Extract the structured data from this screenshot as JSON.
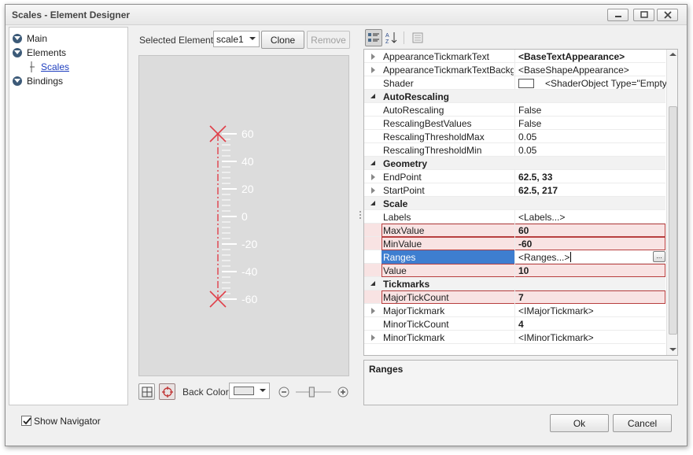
{
  "window": {
    "title": "Scales - Element Designer"
  },
  "nav": {
    "items": [
      {
        "label": "Main"
      },
      {
        "label": "Elements"
      },
      {
        "label": "Scales"
      },
      {
        "label": "Bindings"
      }
    ]
  },
  "selector": {
    "label": "Selected Element:",
    "value": "scale1",
    "clone_label": "Clone",
    "remove_label": "Remove"
  },
  "preview": {
    "ticks": [
      "60",
      "40",
      "20",
      "0",
      "-20",
      "-40",
      "-60"
    ],
    "max_value": 60,
    "min_value": -60,
    "major_tick_count": 7,
    "minor_tick_count": 4
  },
  "bottom_toolbar": {
    "back_color_label": "Back Color:",
    "zoom": 0.45
  },
  "grid": {
    "rows": [
      {
        "kind": "prop",
        "name": "AppearanceTickmarkText",
        "value": "<BaseTextAppearance>",
        "bold": true,
        "expand": true
      },
      {
        "kind": "prop",
        "name": "AppearanceTickmarkTextBackgrou",
        "value": "<BaseShapeAppearance>",
        "bold": false,
        "expand": true
      },
      {
        "kind": "prop",
        "name": "Shader",
        "value": "<ShaderObject Type=\"Empty\"/>",
        "bold": false,
        "expand": false,
        "swatch": true
      },
      {
        "kind": "cat",
        "name": "AutoRescaling"
      },
      {
        "kind": "prop",
        "name": "AutoRescaling",
        "value": "False",
        "bold": false
      },
      {
        "kind": "prop",
        "name": "RescalingBestValues",
        "value": "False",
        "bold": false
      },
      {
        "kind": "prop",
        "name": "RescalingThresholdMax",
        "value": "0.05",
        "bold": false
      },
      {
        "kind": "prop",
        "name": "RescalingThresholdMin",
        "value": "0.05",
        "bold": false
      },
      {
        "kind": "cat",
        "name": "Geometry"
      },
      {
        "kind": "prop",
        "name": "EndPoint",
        "value": "62.5, 33",
        "bold": true,
        "expand": true
      },
      {
        "kind": "prop",
        "name": "StartPoint",
        "value": "62.5, 217",
        "bold": true,
        "expand": true
      },
      {
        "kind": "cat",
        "name": "Scale"
      },
      {
        "kind": "prop",
        "name": "Labels",
        "value": "<Labels...>",
        "bold": false
      },
      {
        "kind": "prop",
        "name": "MaxValue",
        "value": "60",
        "bold": true,
        "highlight": true
      },
      {
        "kind": "prop",
        "name": "MinValue",
        "value": "-60",
        "bold": true,
        "highlight": true
      },
      {
        "kind": "prop",
        "name": "Ranges",
        "value": "<Ranges...>",
        "bold": false,
        "selected": true
      },
      {
        "kind": "prop",
        "name": "Value",
        "value": "10",
        "bold": true,
        "highlight": true
      },
      {
        "kind": "cat",
        "name": "Tickmarks"
      },
      {
        "kind": "prop",
        "name": "MajorTickCount",
        "value": "7",
        "bold": true,
        "highlight": true
      },
      {
        "kind": "prop",
        "name": "MajorTickmark",
        "value": "<IMajorTickmark>",
        "bold": false,
        "expand": true
      },
      {
        "kind": "prop",
        "name": "MinorTickCount",
        "value": "4",
        "bold": true
      },
      {
        "kind": "prop",
        "name": "MinorTickmark",
        "value": "<IMinorTickmark>",
        "bold": false,
        "expand": true
      }
    ]
  },
  "description": {
    "title": "Ranges"
  },
  "footer": {
    "show_navigator_label": "Show Navigator",
    "show_navigator_checked": true,
    "ok_label": "Ok",
    "cancel_label": "Cancel"
  },
  "colors": {
    "accent": "#3e7ed0",
    "highlight_bg": "#f8e3e3",
    "highlight_border": "#b83f3f",
    "scale_red": "#e0404a"
  }
}
